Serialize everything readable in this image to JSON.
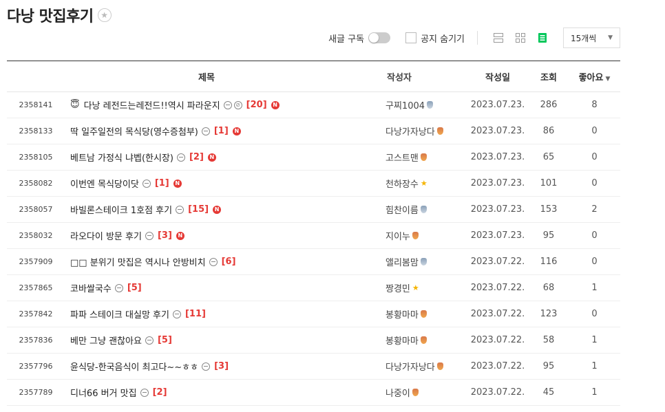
{
  "board": {
    "title": "다낭 맛집후기",
    "star_icon": "star-outline-icon"
  },
  "toolbar": {
    "subscribe_label": "새글 구독",
    "hide_notice_label": "공지 숨기기",
    "per_page": "15개씩",
    "active_view": "list"
  },
  "table": {
    "headers": {
      "title": "제목",
      "author": "작성자",
      "date": "작성일",
      "views": "조회",
      "likes": "좋아요"
    },
    "rows": [
      {
        "no": "2358141",
        "emoji": "😇",
        "title": "다낭 레전드는레전드!!역시 파라운지",
        "img": true,
        "clip": true,
        "comments": "[20]",
        "new": true,
        "author": "구찌1004",
        "medal": "silver",
        "date": "2023.07.23.",
        "views": "286",
        "likes": "8"
      },
      {
        "no": "2358133",
        "emoji": "",
        "title": "딱 일주일전의 목식당(영수증첨부)",
        "img": true,
        "clip": false,
        "comments": "[1]",
        "new": true,
        "author": "다낭가자낭다",
        "medal": "bronze",
        "date": "2023.07.23.",
        "views": "86",
        "likes": "0"
      },
      {
        "no": "2358105",
        "emoji": "",
        "title": "베트남 가정식 냐벱(한시장)",
        "img": true,
        "clip": false,
        "comments": "[2]",
        "new": true,
        "author": "고스트맨",
        "medal": "bronze",
        "date": "2023.07.23.",
        "views": "65",
        "likes": "0"
      },
      {
        "no": "2358082",
        "emoji": "",
        "title": "이번엔 목식당이닷",
        "img": true,
        "clip": false,
        "comments": "[1]",
        "new": true,
        "author": "천하장수",
        "medal": "star",
        "date": "2023.07.23.",
        "views": "101",
        "likes": "0"
      },
      {
        "no": "2358057",
        "emoji": "",
        "title": "바빌론스테이크 1호점 후기",
        "img": true,
        "clip": false,
        "comments": "[15]",
        "new": true,
        "author": "힘찬이름",
        "medal": "silver",
        "date": "2023.07.23.",
        "views": "153",
        "likes": "2"
      },
      {
        "no": "2358032",
        "emoji": "",
        "title": "라오다이 방문 후기",
        "img": true,
        "clip": false,
        "comments": "[3]",
        "new": true,
        "author": "지이누",
        "medal": "bronze",
        "date": "2023.07.23.",
        "views": "95",
        "likes": "0"
      },
      {
        "no": "2357909",
        "emoji": "",
        "title": "□□ 분위기 맛집은 역시나 안방비치",
        "img": true,
        "clip": false,
        "comments": "[6]",
        "new": false,
        "author": "앨리봄맘",
        "medal": "silver",
        "date": "2023.07.22.",
        "views": "116",
        "likes": "0"
      },
      {
        "no": "2357865",
        "emoji": "",
        "title": "코바쌀국수",
        "img": true,
        "clip": false,
        "comments": "[5]",
        "new": false,
        "author": "짱경민",
        "medal": "star",
        "date": "2023.07.22.",
        "views": "68",
        "likes": "1"
      },
      {
        "no": "2357842",
        "emoji": "",
        "title": "파파 스테이크 대실망 후기",
        "img": true,
        "clip": false,
        "comments": "[11]",
        "new": false,
        "author": "봉황마마",
        "medal": "bronze",
        "date": "2023.07.22.",
        "views": "123",
        "likes": "0"
      },
      {
        "no": "2357836",
        "emoji": "",
        "title": "베만 그냥 괜찮아요",
        "img": true,
        "clip": false,
        "comments": "[5]",
        "new": false,
        "author": "봉황마마",
        "medal": "bronze",
        "date": "2023.07.22.",
        "views": "58",
        "likes": "1"
      },
      {
        "no": "2357796",
        "emoji": "",
        "title": "윤식당-한국음식이 최고다~~ㅎㅎ",
        "img": true,
        "clip": false,
        "comments": "[3]",
        "new": false,
        "author": "다낭가자낭다",
        "medal": "bronze",
        "date": "2023.07.22.",
        "views": "95",
        "likes": "1"
      },
      {
        "no": "2357789",
        "emoji": "",
        "title": "디너66 버거 맛집",
        "img": true,
        "clip": false,
        "comments": "[2]",
        "new": false,
        "author": "나중이",
        "medal": "bronze",
        "date": "2023.07.22.",
        "views": "45",
        "likes": "1"
      }
    ]
  },
  "colors": {
    "accent_green": "#03c75a",
    "comment_red": "#e53935"
  }
}
